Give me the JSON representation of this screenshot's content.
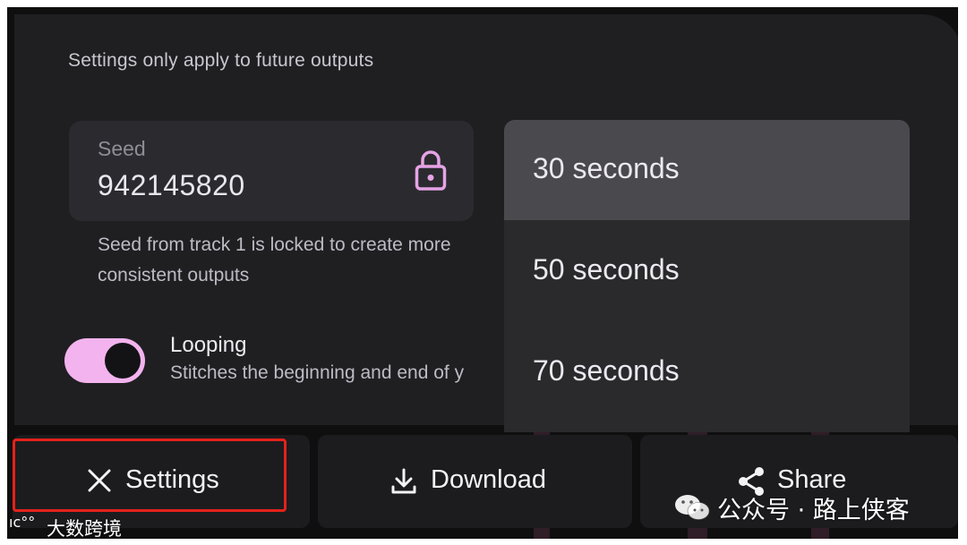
{
  "settings_panel": {
    "note": "Settings only apply to future outputs",
    "seed": {
      "label": "Seed",
      "value": "942145820",
      "help": "Seed from track 1 is locked to create more consistent outputs"
    },
    "looping": {
      "title": "Looping",
      "description": "Stitches the beginning and end of y",
      "enabled": true
    },
    "duration_options": [
      "30 seconds",
      "50 seconds",
      "70 seconds"
    ],
    "selected_duration": "30 seconds"
  },
  "actions": {
    "settings_label": "Settings",
    "download_label": "Download",
    "share_label": "Share"
  },
  "watermarks": {
    "wechat": "公众号 · 路上侠客",
    "source": "大数跨境"
  },
  "colors": {
    "toggle_on": "#f3b3ee",
    "lock_icon": "#e6a3e6",
    "highlight": "#e5221b"
  }
}
